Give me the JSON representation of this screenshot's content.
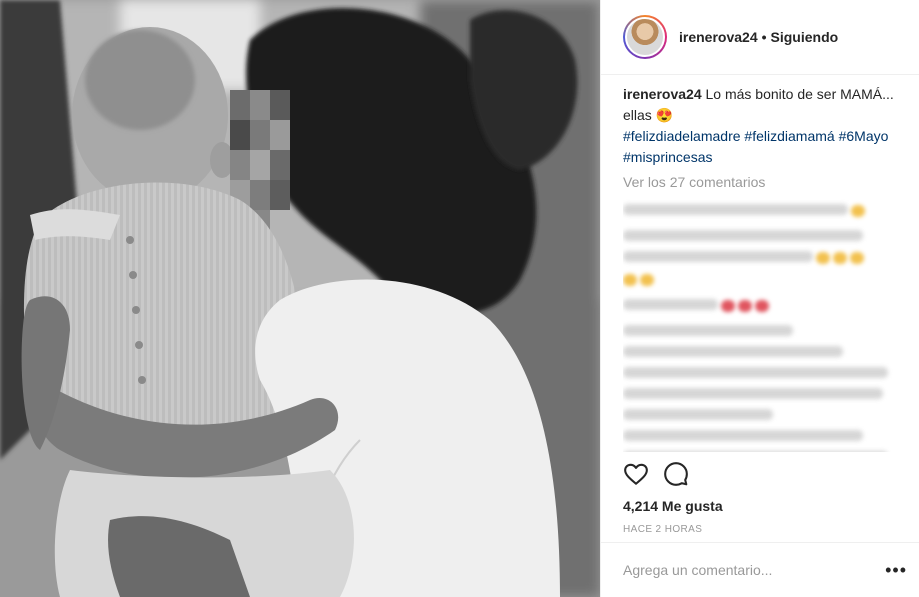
{
  "post": {
    "username": "irenerova24",
    "follow_status": "Siguiendo",
    "caption": {
      "username": "irenerova24",
      "text": "Lo más bonito de ser MAMÁ... ellas",
      "emoji": "😍",
      "hashtags": [
        "#felizdiadelamadre",
        "#felizdiamamá",
        "#6Mayo",
        "#misprincesas"
      ]
    },
    "view_all_comments": "Ver los 27 comentarios",
    "likes": "4,214 Me gusta",
    "timestamp": "HACE 2 HORAS",
    "comment_placeholder": "Agrega un comentario...",
    "more_options": "•••"
  },
  "icons": {
    "like": "heart-icon",
    "comment": "comment-bubble-icon",
    "options": "more-options-icon"
  },
  "colors": {
    "hashtag": "#003569",
    "muted": "#999999",
    "text": "#262626",
    "border": "#efefef"
  }
}
